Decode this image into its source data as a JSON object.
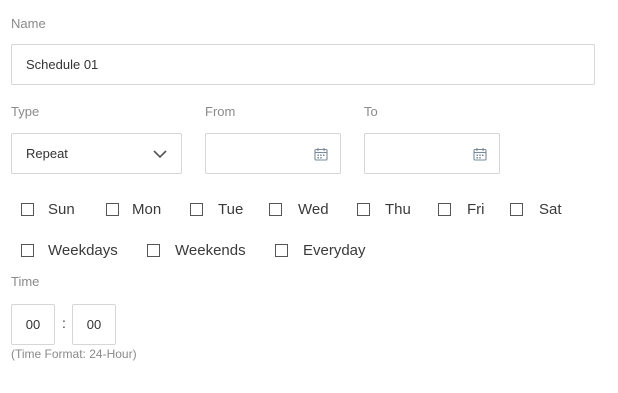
{
  "name": {
    "label": "Name",
    "value": "Schedule 01"
  },
  "type": {
    "label": "Type",
    "selected": "Repeat",
    "icon": "chevron-down-icon"
  },
  "from": {
    "label": "From",
    "value": "",
    "icon": "calendar-icon"
  },
  "to": {
    "label": "To",
    "value": "",
    "icon": "calendar-icon"
  },
  "days": [
    {
      "label": "Sun",
      "checked": false
    },
    {
      "label": "Mon",
      "checked": false
    },
    {
      "label": "Tue",
      "checked": false
    },
    {
      "label": "Wed",
      "checked": false
    },
    {
      "label": "Thu",
      "checked": false
    },
    {
      "label": "Fri",
      "checked": false
    },
    {
      "label": "Sat",
      "checked": false
    }
  ],
  "presets": [
    {
      "label": "Weekdays",
      "checked": false
    },
    {
      "label": "Weekends",
      "checked": false
    },
    {
      "label": "Everyday",
      "checked": false
    }
  ],
  "time": {
    "label": "Time",
    "hour": "00",
    "separator": ":",
    "minute": "00",
    "hint": "(Time Format: 24-Hour)"
  },
  "colors": {
    "border": "#d6d6d6",
    "label": "#8a8a8a",
    "text": "#333333",
    "icon": "#7a8a9a"
  }
}
